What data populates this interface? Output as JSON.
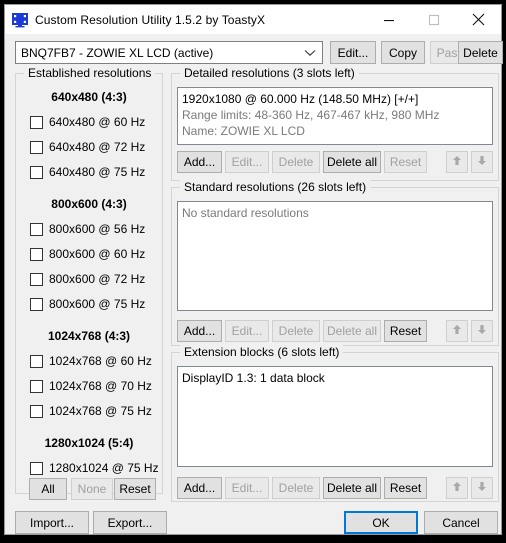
{
  "window": {
    "title": "Custom Resolution Utility 1.5.2 by ToastyX",
    "icon": "monitor-icon",
    "accent": "#0078d7",
    "controls": {
      "minimize": "minimize-icon",
      "maximize": "maximize-icon",
      "close": "close-icon"
    }
  },
  "display": {
    "selected": "BNQ7FB7 - ZOWIE XL LCD (active)",
    "dropdown_icon": "chevron-down-icon",
    "buttons": [
      {
        "label": "Edit...",
        "enabled": true
      },
      {
        "label": "Copy",
        "enabled": true
      },
      {
        "label": "Paste",
        "enabled": false
      },
      {
        "label": "Delete",
        "enabled": true
      }
    ]
  },
  "established": {
    "legend": "Established resolutions",
    "groups": [
      {
        "heading": "640x480 (4:3)",
        "items": [
          {
            "label": "640x480 @ 60 Hz",
            "checked": false
          },
          {
            "label": "640x480 @ 72 Hz",
            "checked": false
          },
          {
            "label": "640x480 @ 75 Hz",
            "checked": false
          }
        ]
      },
      {
        "heading": "800x600 (4:3)",
        "items": [
          {
            "label": "800x600 @ 56 Hz",
            "checked": false
          },
          {
            "label": "800x600 @ 60 Hz",
            "checked": false
          },
          {
            "label": "800x600 @ 72 Hz",
            "checked": false
          },
          {
            "label": "800x600 @ 75 Hz",
            "checked": false
          }
        ]
      },
      {
        "heading": "1024x768 (4:3)",
        "items": [
          {
            "label": "1024x768 @ 60 Hz",
            "checked": false
          },
          {
            "label": "1024x768 @ 70 Hz",
            "checked": false
          },
          {
            "label": "1024x768 @ 75 Hz",
            "checked": false
          }
        ]
      },
      {
        "heading": "1280x1024 (5:4)",
        "items": [
          {
            "label": "1280x1024 @ 75 Hz",
            "checked": false
          }
        ]
      }
    ],
    "buttons": [
      {
        "label": "All",
        "enabled": true
      },
      {
        "label": "None",
        "enabled": false
      },
      {
        "label": "Reset",
        "enabled": true
      }
    ]
  },
  "detailed": {
    "legend": "Detailed resolutions (3 slots left)",
    "lines": [
      {
        "text": "1920x1080 @ 60.000 Hz (148.50 MHz) [+/+]",
        "dim": false
      },
      {
        "text": "Range limits: 48-360 Hz, 467-467 kHz, 980 MHz",
        "dim": true
      },
      {
        "text": "Name: ZOWIE XL LCD",
        "dim": true
      }
    ],
    "buttons": [
      {
        "label": "Add...",
        "enabled": true
      },
      {
        "label": "Edit...",
        "enabled": false
      },
      {
        "label": "Delete",
        "enabled": false
      },
      {
        "label": "Delete all",
        "enabled": true
      },
      {
        "label": "Reset",
        "enabled": false
      }
    ],
    "move_up_icon": "arrow-up-icon",
    "move_down_icon": "arrow-down-icon"
  },
  "standard": {
    "legend": "Standard resolutions (26 slots left)",
    "lines": [
      {
        "text": "No standard resolutions",
        "dim": true
      }
    ],
    "buttons": [
      {
        "label": "Add...",
        "enabled": true
      },
      {
        "label": "Edit...",
        "enabled": false
      },
      {
        "label": "Delete",
        "enabled": false
      },
      {
        "label": "Delete all",
        "enabled": false
      },
      {
        "label": "Reset",
        "enabled": true
      }
    ],
    "move_up_icon": "arrow-up-icon",
    "move_down_icon": "arrow-down-icon"
  },
  "extension": {
    "legend": "Extension blocks (6 slots left)",
    "lines": [
      {
        "text": "DisplayID 1.3: 1 data block",
        "dim": false
      }
    ],
    "buttons": [
      {
        "label": "Add...",
        "enabled": true
      },
      {
        "label": "Edit...",
        "enabled": false
      },
      {
        "label": "Delete",
        "enabled": false
      },
      {
        "label": "Delete all",
        "enabled": true
      },
      {
        "label": "Reset",
        "enabled": true
      }
    ],
    "move_up_icon": "arrow-up-icon",
    "move_down_icon": "arrow-down-icon"
  },
  "footer": {
    "import_label": "Import...",
    "export_label": "Export...",
    "ok_label": "OK",
    "cancel_label": "Cancel"
  }
}
